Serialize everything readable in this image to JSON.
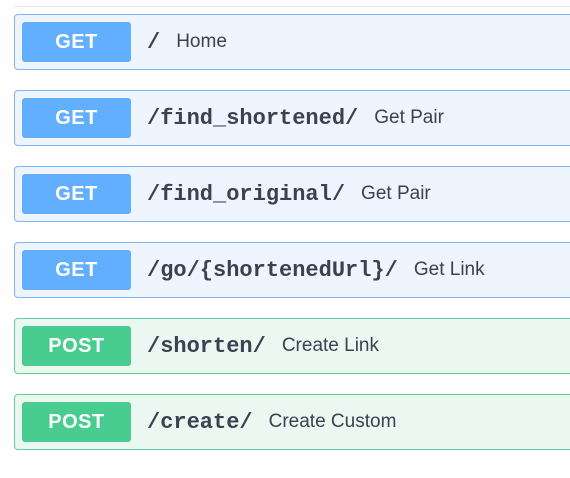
{
  "operations": [
    {
      "method": "GET",
      "path": "/",
      "summary": "Home"
    },
    {
      "method": "GET",
      "path": "/find_shortened/",
      "summary": "Get Pair"
    },
    {
      "method": "GET",
      "path": "/find_original/",
      "summary": "Get Pair"
    },
    {
      "method": "GET",
      "path": "/go/{shortenedUrl}/",
      "summary": "Get Link"
    },
    {
      "method": "POST",
      "path": "/shorten/",
      "summary": "Create Link"
    },
    {
      "method": "POST",
      "path": "/create/",
      "summary": "Create Custom"
    }
  ],
  "colors": {
    "get_badge": "#61affe",
    "post_badge": "#49cc90",
    "get_background": "#eef5ff",
    "post_background": "#ebf7f1",
    "text": "#3b4151"
  }
}
